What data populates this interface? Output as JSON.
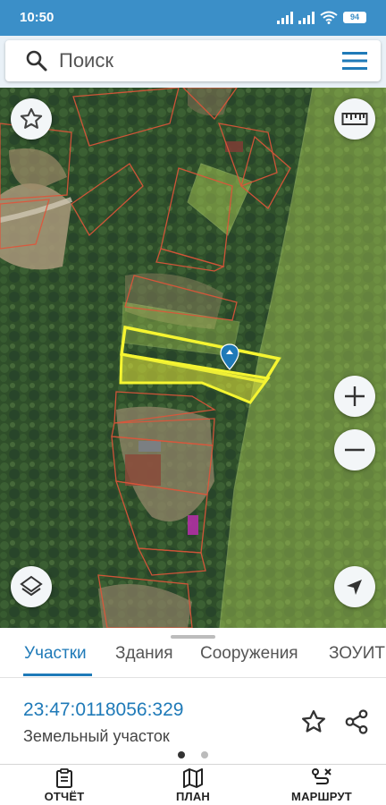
{
  "status_bar": {
    "time": "10:50",
    "battery": "94",
    "icons": [
      "signal-icon",
      "signal-icon",
      "wifi-icon",
      "battery-icon"
    ]
  },
  "search": {
    "placeholder": "Поиск",
    "icons": [
      "search-icon",
      "menu-icon"
    ]
  },
  "map": {
    "controls": [
      "favorite-star-icon",
      "ruler-icon",
      "zoom-in-icon",
      "zoom-out-icon",
      "layers-icon",
      "navigation-arrow-icon"
    ],
    "colors": {
      "forest": "#2f4f2a",
      "zone_fill": "#b8d85a",
      "parcel_border": "#e0553a",
      "selected_border": "#f5f531",
      "selected_fill": "#e5e83a",
      "marker": "#1f7ab8"
    }
  },
  "tabs": {
    "items": [
      {
        "label": "Участки"
      },
      {
        "label": "Здания"
      },
      {
        "label": "Сооружения"
      },
      {
        "label": "ЗОУИТ"
      }
    ],
    "active_index": 0
  },
  "info": {
    "cadastral_number": "23:47:0118056:329",
    "type": "Земельный участок",
    "icons": [
      "star-outline-icon",
      "share-icon"
    ],
    "page_current": 1,
    "page_total": 2
  },
  "bottom_nav": {
    "items": [
      {
        "label": "ОТЧЁТ",
        "icon": "clipboard-icon"
      },
      {
        "label": "ПЛАН",
        "icon": "map-icon"
      },
      {
        "label": "МАРШРУТ",
        "icon": "route-icon"
      }
    ]
  },
  "colors": {
    "accent": "#1f7ab8",
    "status_bar": "#3b8fc8"
  }
}
